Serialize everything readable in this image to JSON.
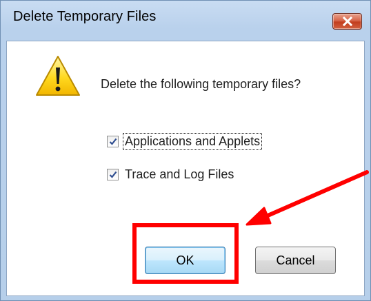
{
  "dialog": {
    "title": "Delete Temporary Files",
    "prompt": "Delete the following temporary files?",
    "options": [
      {
        "label": "Applications and Applets",
        "checked": true,
        "focused": true
      },
      {
        "label": "Trace and Log Files",
        "checked": true,
        "focused": false
      }
    ],
    "ok_label": "OK",
    "cancel_label": "Cancel"
  },
  "icons": {
    "title_close": "close-icon",
    "message": "warning-icon",
    "checkmark": "checkmark-icon"
  },
  "annotation": {
    "color": "#ff0000",
    "target": "ok-button"
  },
  "colors": {
    "title_bar": "#b9d1ec",
    "close_button": "#c23e1f",
    "default_button_border": "#3c7fb1"
  }
}
